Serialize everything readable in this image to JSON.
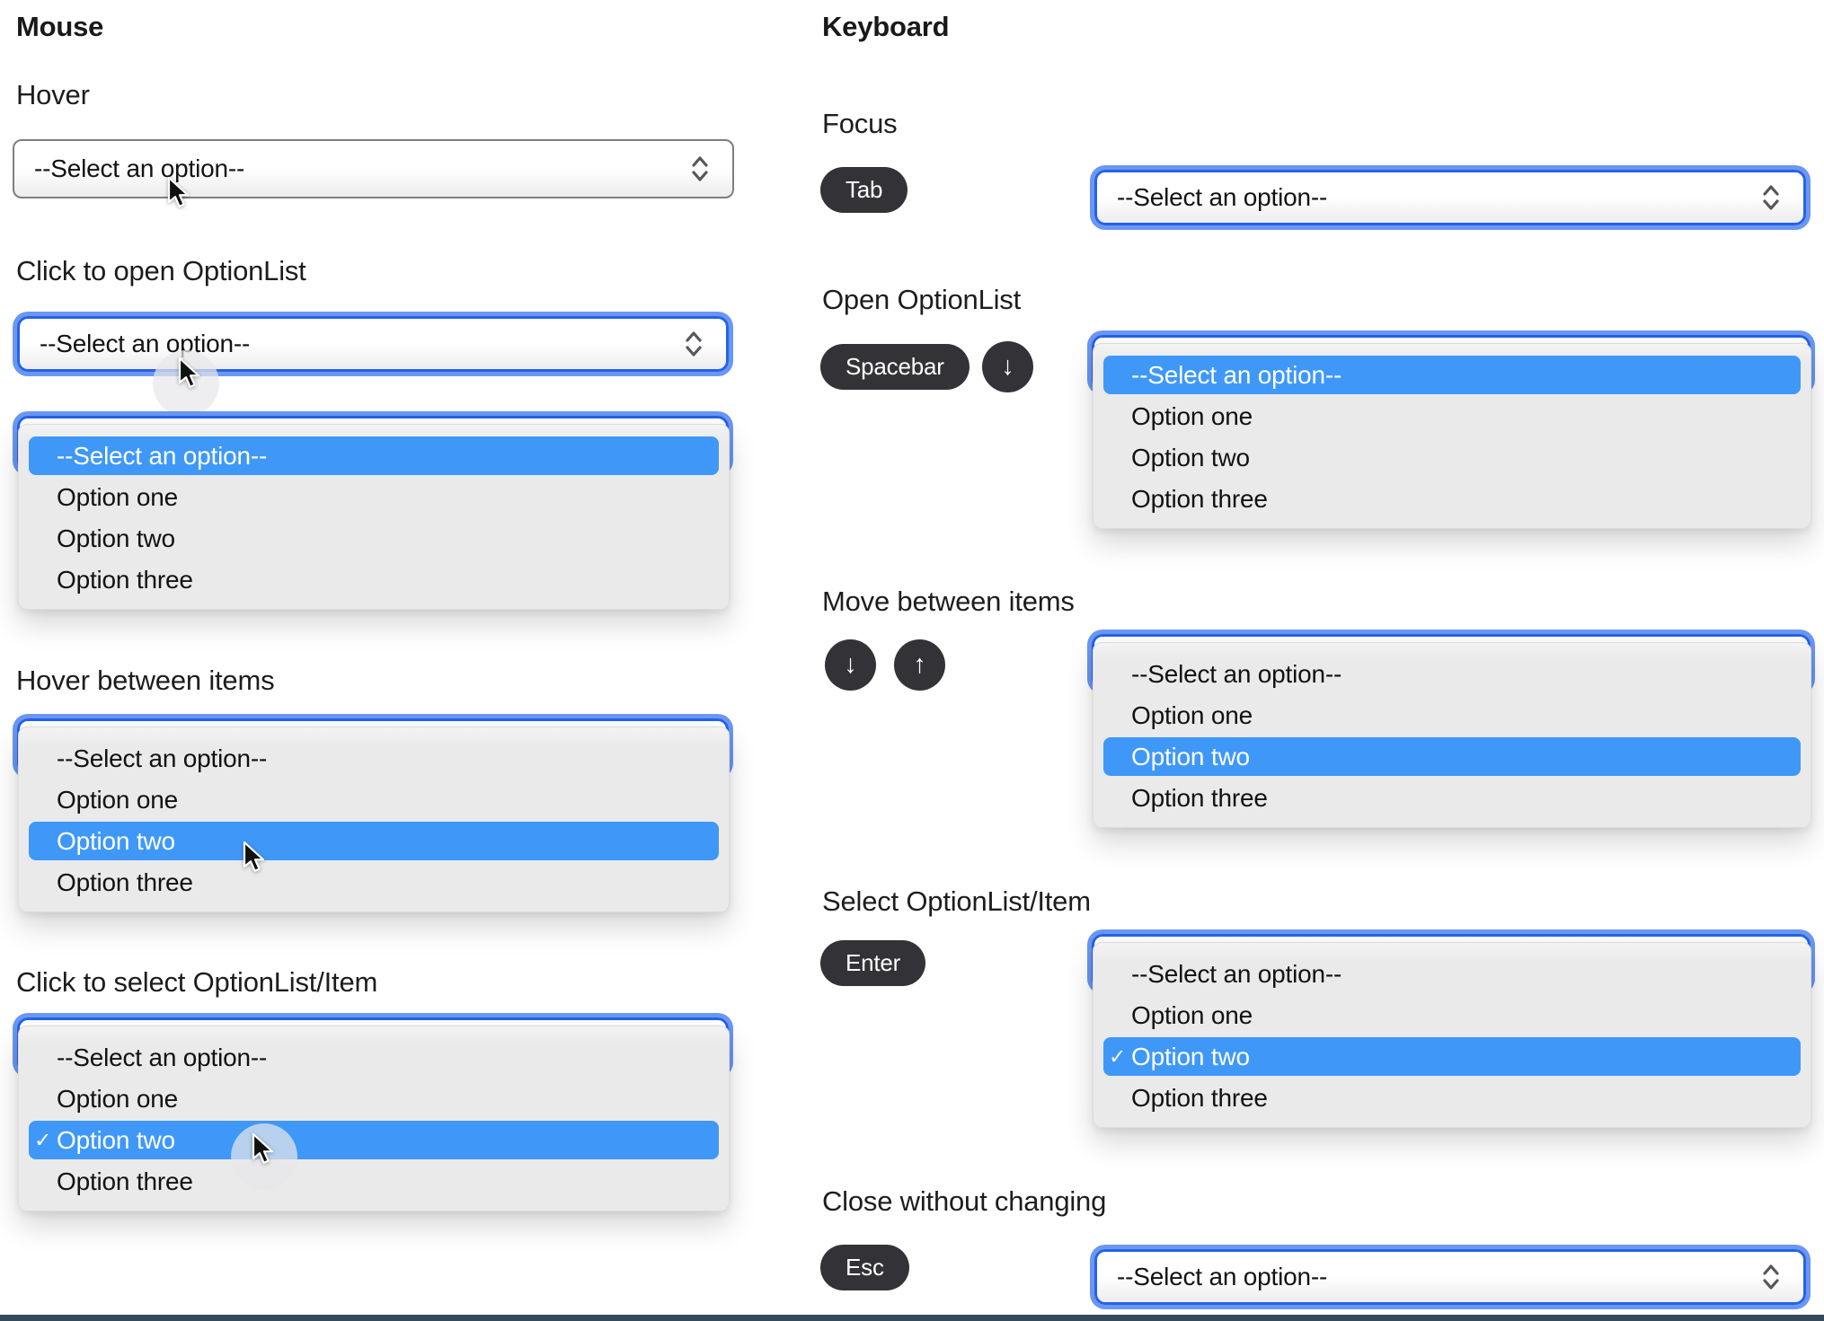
{
  "select": {
    "placeholder": "--Select an option--"
  },
  "options": [
    "--Select an option--",
    "Option one",
    "Option two",
    "Option three"
  ],
  "glyphs": {
    "check": "✓",
    "arrow_down": "↓",
    "arrow_up": "↑"
  },
  "mouse": {
    "heading": "Mouse",
    "hover_label": "Hover",
    "click_open_label": "Click to open OptionList",
    "hover_items_label": "Hover between items",
    "click_select_label": "Click to select OptionList/Item"
  },
  "keyboard": {
    "heading": "Keyboard",
    "focus_label": "Focus",
    "open_label": "Open OptionList",
    "move_label": "Move between items",
    "select_label": "Select OptionList/Item",
    "close_label": "Close without changing",
    "keys": {
      "tab": "Tab",
      "spacebar": "Spacebar",
      "enter": "Enter",
      "esc": "Esc"
    }
  },
  "colors": {
    "highlight_blue": "#3F98F8",
    "focus_border_blue": "#2462E9",
    "focus_ring_blue": "#6B97F2",
    "key_badge_bg": "#333236",
    "list_bg": "#EAEAEB",
    "bottom_bar": "#34495A"
  }
}
